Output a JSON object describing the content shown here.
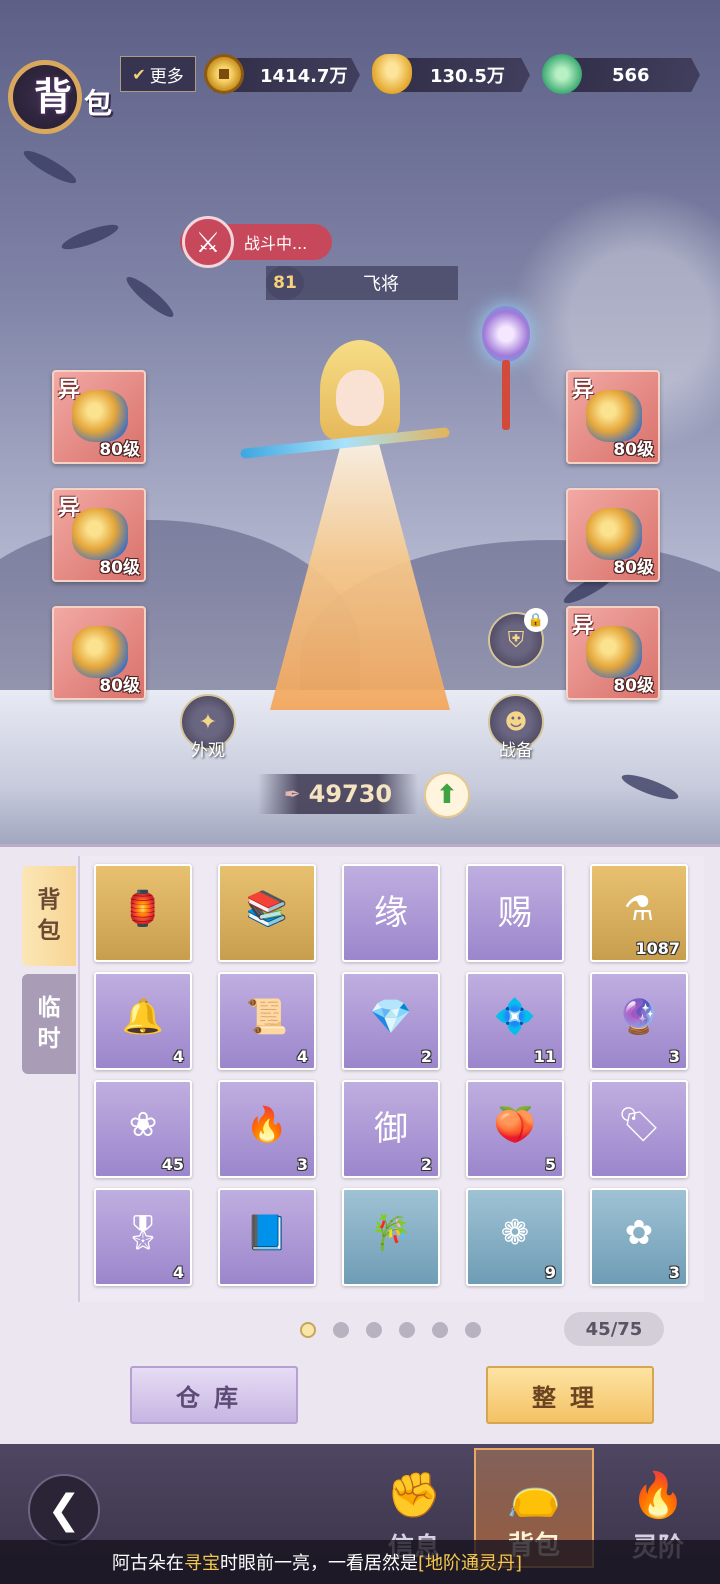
{
  "header": {
    "title_char1": "背",
    "title_char2": "包",
    "more_label": "更多",
    "currencies": [
      {
        "name": "coin-icon",
        "value": "1414.7万"
      },
      {
        "name": "ingot-icon",
        "value": "130.5万"
      },
      {
        "name": "jade-icon",
        "value": "566"
      }
    ]
  },
  "hero": {
    "status": "战斗中...",
    "level": "81",
    "name": "飞将",
    "power": "49730"
  },
  "equipment": {
    "left": [
      {
        "tag": "异",
        "level": "80级"
      },
      {
        "tag": "异",
        "level": "80级"
      },
      {
        "tag": "",
        "level": "80级"
      }
    ],
    "right": [
      {
        "tag": "异",
        "level": "80级"
      },
      {
        "tag": "",
        "level": "80级"
      },
      {
        "tag": "异",
        "level": "80级"
      }
    ]
  },
  "actions": {
    "appearance": "外观",
    "gear": "战备"
  },
  "tabs": {
    "bag": [
      "背",
      "包"
    ],
    "temp": [
      "临",
      "时"
    ]
  },
  "items": [
    {
      "icon": "lantern-icon",
      "glyph": "🏮",
      "count": "",
      "bg": "gold"
    },
    {
      "icon": "books-icon",
      "glyph": "📚",
      "count": "",
      "bg": "gold"
    },
    {
      "icon": "token-yuan-icon",
      "glyph": "缘",
      "count": "",
      "bg": "purple"
    },
    {
      "icon": "decree-ci-icon",
      "glyph": "赐",
      "count": "",
      "bg": "purple"
    },
    {
      "icon": "potion-icon",
      "glyph": "⚗",
      "count": "1087",
      "bg": "gold"
    },
    {
      "icon": "bell-icon",
      "glyph": "🔔",
      "count": "4",
      "bg": "purple"
    },
    {
      "icon": "scroll-icon",
      "glyph": "📜",
      "count": "4",
      "bg": "purple"
    },
    {
      "icon": "gem-blue-icon",
      "glyph": "💎",
      "count": "2",
      "bg": "purple"
    },
    {
      "icon": "gem-pink-icon",
      "glyph": "💠",
      "count": "11",
      "bg": "purple"
    },
    {
      "icon": "crystal-ball-icon",
      "glyph": "🔮",
      "count": "3",
      "bg": "purple"
    },
    {
      "icon": "lotus-icon",
      "glyph": "❀",
      "count": "45",
      "bg": "purple"
    },
    {
      "icon": "fire-stone-icon",
      "glyph": "🔥",
      "count": "3",
      "bg": "purple"
    },
    {
      "icon": "token-yu-icon",
      "glyph": "御",
      "count": "2",
      "bg": "purple"
    },
    {
      "icon": "orb-red-icon",
      "glyph": "🍑",
      "count": "5",
      "bg": "purple"
    },
    {
      "icon": "plaque-icon",
      "glyph": "🏷",
      "count": "",
      "bg": "purple"
    },
    {
      "icon": "medal-icon",
      "glyph": "🎖",
      "count": "4",
      "bg": "purple"
    },
    {
      "icon": "tome-icon",
      "glyph": "📘",
      "count": "",
      "bg": "purple"
    },
    {
      "icon": "bamboo-icon",
      "glyph": "🎋",
      "count": "",
      "bg": "blue"
    },
    {
      "icon": "white-flower-icon",
      "glyph": "❁",
      "count": "9",
      "bg": "blue"
    },
    {
      "icon": "yellow-flower-icon",
      "glyph": "✿",
      "count": "3",
      "bg": "blue"
    }
  ],
  "pagination": {
    "pages": 6,
    "current": 1,
    "capacity": "45/75"
  },
  "buttons": {
    "warehouse": "仓库",
    "sort": "整理"
  },
  "nav": {
    "info": "信息",
    "bag": "背包",
    "spirit": "灵阶"
  },
  "ticker": {
    "part1": "阿古朵在",
    "part2": "寻宝",
    "part3": "时眼前一亮，一看居然是",
    "part4": "[地阶通灵丹]"
  },
  "colors": {
    "equip_bg": "#d9706a",
    "battle_red": "#c7485a",
    "gold_item": "#e8c170",
    "purple_item": "#9c86cc",
    "blue_item": "#6f9db6"
  }
}
